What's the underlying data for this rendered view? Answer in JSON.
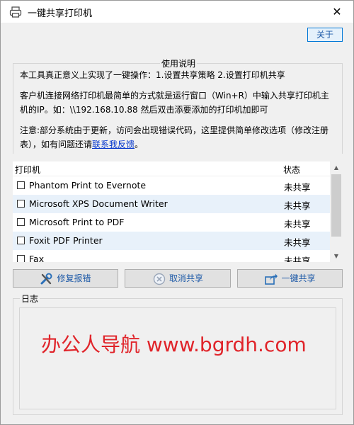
{
  "window": {
    "title": "一键共享打印机",
    "close_glyph": "✕"
  },
  "about_label": "关于",
  "usage": {
    "title": "使用说明",
    "line1": "本工具真正意义上实现了一键操作：1.设置共享策略 2.设置打印机共享",
    "line2": "客户机连接网络打印机最简单的方式就是运行窗口（Win+R）中输入共享打印机主",
    "line3": "机的IP。如：\\\\192.168.10.88 然后双击添要添加的打印机加即可",
    "line4": "注意:部分系统由于更新，访问会出现错误代码，这里提供简单修改选项（修改注册",
    "line5_prefix": "表），如有问题还请",
    "line5_link": "联系我反馈",
    "line5_suffix": "。"
  },
  "printer_list": {
    "col_printer": "打印机",
    "col_status": "状态",
    "rows": [
      {
        "name": "Phantom Print to Evernote",
        "status": "未共享"
      },
      {
        "name": "Microsoft XPS Document Writer",
        "status": "未共享"
      },
      {
        "name": "Microsoft Print to PDF",
        "status": "未共享"
      },
      {
        "name": "Foxit PDF Printer",
        "status": "未共享"
      },
      {
        "name": "Fax",
        "status": "未共享"
      }
    ]
  },
  "actions": {
    "repair_label": "修复报错",
    "cancel_label": "取消共享",
    "share_label": "一键共享"
  },
  "log": {
    "title": "日志",
    "watermark": "办公人导航 www.bgrdh.com"
  },
  "colors": {
    "accent": "#0078d7",
    "link": "#0033cc",
    "watermark": "#e0242a"
  }
}
